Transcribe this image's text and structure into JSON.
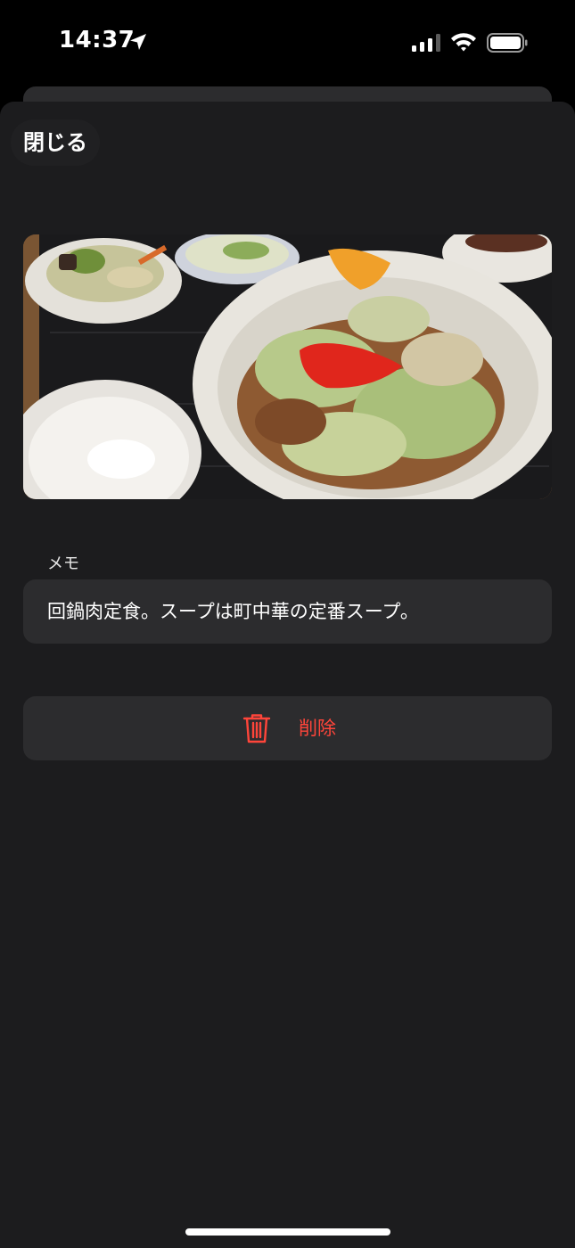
{
  "status_bar": {
    "time": "14:37",
    "icons": [
      "location-arrow-icon",
      "cellular-signal-icon",
      "wifi-icon",
      "battery-icon"
    ]
  },
  "sheet": {
    "close_label": "閉じる"
  },
  "memo": {
    "label": "メモ",
    "text": "回鍋肉定食。スープは町中華の定番スープ。"
  },
  "delete": {
    "label": "削除",
    "icon": "trash-icon",
    "color": "#ff453a"
  },
  "colors": {
    "background": "#1c1c1e",
    "card": "#2c2c2e",
    "destructive": "#ff453a"
  }
}
